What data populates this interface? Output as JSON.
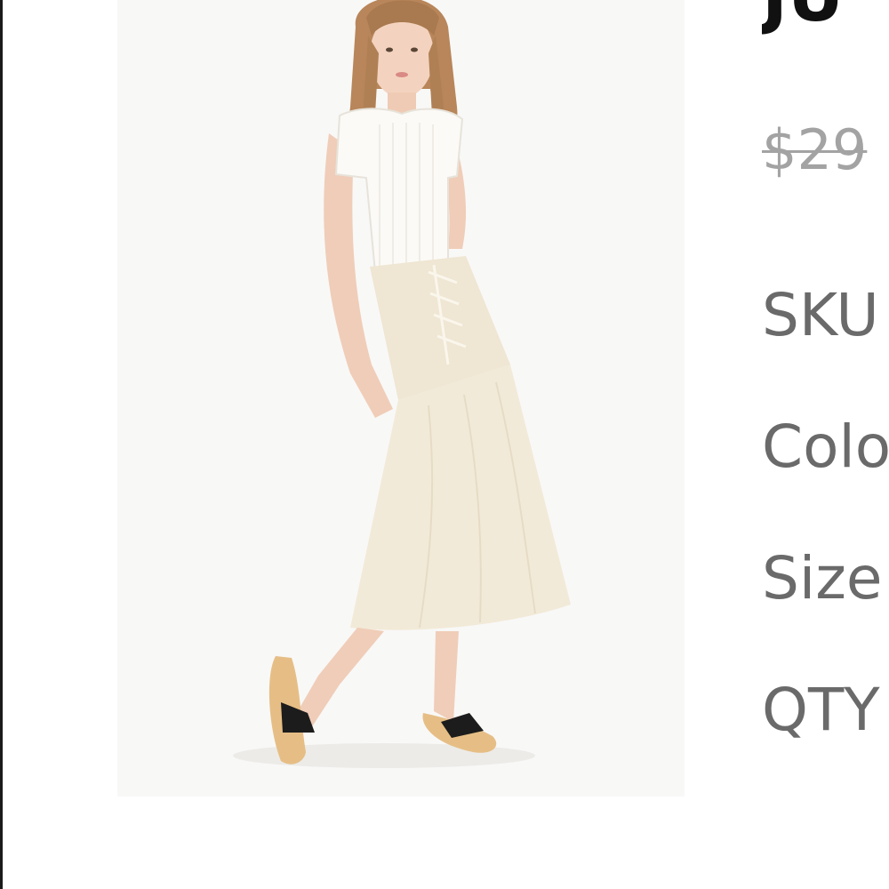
{
  "product": {
    "title": "JU",
    "original_price": "$29",
    "image_alt": "Model wearing white ribbed tee, cream lace-up tiered midi skirt and black bow slide sandals",
    "attributes": {
      "sku_label": "SKU",
      "color_label": "Colo",
      "size_label": "Size",
      "qty_label": "QTY"
    }
  },
  "colors": {
    "title_text": "#111111",
    "strike_price": "#a3a3a3",
    "attribute_text": "#6a6a6a",
    "image_background": "#f8f8f7"
  }
}
